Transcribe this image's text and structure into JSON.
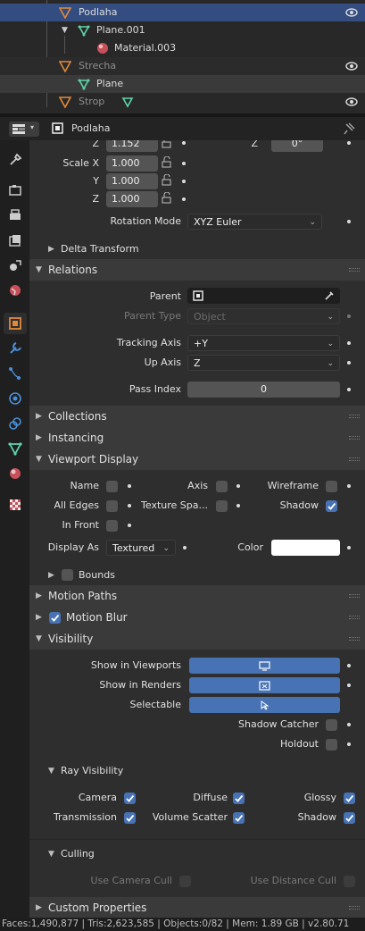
{
  "outliner": {
    "rows": [
      {
        "label": "Podlaha"
      },
      {
        "label": "Plane.001"
      },
      {
        "label": "Material.003"
      },
      {
        "label": "Strecha"
      },
      {
        "label": "Plane"
      },
      {
        "label": "Strop"
      }
    ]
  },
  "header": {
    "object_name": "Podlaha"
  },
  "transform": {
    "rot_z_label": "Z",
    "loc_z_value": "1.152",
    "rot_z_value": "0°",
    "scale_x_label": "Scale X",
    "scale_x": "1.000",
    "scale_y_label": "Y",
    "scale_y": "1.000",
    "scale_z_label": "Z",
    "scale_z": "1.000",
    "rotation_mode_label": "Rotation Mode",
    "rotation_mode_value": "XYZ Euler",
    "delta_transform": "Delta Transform"
  },
  "relations": {
    "title": "Relations",
    "parent_label": "Parent",
    "parent_type_label": "Parent Type",
    "parent_type_value": "Object",
    "tracking_axis_label": "Tracking Axis",
    "tracking_axis_value": "+Y",
    "up_axis_label": "Up Axis",
    "up_axis_value": "Z",
    "pass_index_label": "Pass Index",
    "pass_index_value": "0"
  },
  "panels": {
    "collections": "Collections",
    "instancing": "Instancing",
    "viewport_display": "Viewport Display",
    "motion_paths": "Motion Paths",
    "motion_blur": "Motion Blur",
    "visibility": "Visibility",
    "custom_properties": "Custom Properties"
  },
  "viewport_display": {
    "name": "Name",
    "axis": "Axis",
    "wireframe": "Wireframe",
    "all_edges": "All Edges",
    "texture_space": "Texture Spa...",
    "shadow": "Shadow",
    "in_front": "In Front",
    "display_as_label": "Display As",
    "display_as_value": "Textured",
    "color_label": "Color",
    "color_value": "#ffffff",
    "bounds": "Bounds"
  },
  "visibility": {
    "show_in_viewports": "Show in Viewports",
    "show_in_renders": "Show in Renders",
    "selectable": "Selectable",
    "shadow_catcher": "Shadow Catcher",
    "holdout": "Holdout",
    "ray_visibility": "Ray Visibility",
    "camera": "Camera",
    "diffuse": "Diffuse",
    "glossy": "Glossy",
    "transmission": "Transmission",
    "volume_scatter": "Volume Scatter",
    "shadow": "Shadow",
    "culling": "Culling",
    "use_camera_cull": "Use Camera Cull",
    "use_distance_cull": "Use Distance Cull"
  },
  "status_bar": {
    "text": "Faces:1,490,877 | Tris:2,623,585 | Objects:0/82 | Mem: 1.89 GB | v2.80.71"
  },
  "colors": {
    "accent": "#4772b3",
    "selected_row": "#334d80"
  }
}
